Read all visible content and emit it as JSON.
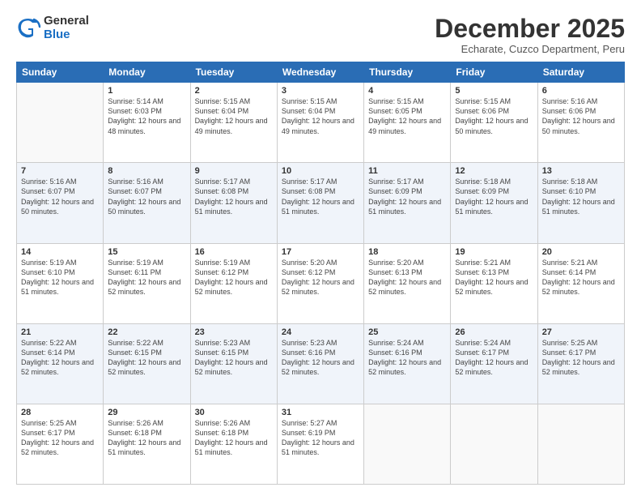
{
  "logo": {
    "general": "General",
    "blue": "Blue"
  },
  "header": {
    "month": "December 2025",
    "location": "Echarate, Cuzco Department, Peru"
  },
  "days_of_week": [
    "Sunday",
    "Monday",
    "Tuesday",
    "Wednesday",
    "Thursday",
    "Friday",
    "Saturday"
  ],
  "weeks": [
    [
      {
        "day": "",
        "sunrise": "",
        "sunset": "",
        "daylight": ""
      },
      {
        "day": "1",
        "sunrise": "Sunrise: 5:14 AM",
        "sunset": "Sunset: 6:03 PM",
        "daylight": "Daylight: 12 hours and 48 minutes."
      },
      {
        "day": "2",
        "sunrise": "Sunrise: 5:15 AM",
        "sunset": "Sunset: 6:04 PM",
        "daylight": "Daylight: 12 hours and 49 minutes."
      },
      {
        "day": "3",
        "sunrise": "Sunrise: 5:15 AM",
        "sunset": "Sunset: 6:04 PM",
        "daylight": "Daylight: 12 hours and 49 minutes."
      },
      {
        "day": "4",
        "sunrise": "Sunrise: 5:15 AM",
        "sunset": "Sunset: 6:05 PM",
        "daylight": "Daylight: 12 hours and 49 minutes."
      },
      {
        "day": "5",
        "sunrise": "Sunrise: 5:15 AM",
        "sunset": "Sunset: 6:06 PM",
        "daylight": "Daylight: 12 hours and 50 minutes."
      },
      {
        "day": "6",
        "sunrise": "Sunrise: 5:16 AM",
        "sunset": "Sunset: 6:06 PM",
        "daylight": "Daylight: 12 hours and 50 minutes."
      }
    ],
    [
      {
        "day": "7",
        "sunrise": "Sunrise: 5:16 AM",
        "sunset": "Sunset: 6:07 PM",
        "daylight": "Daylight: 12 hours and 50 minutes."
      },
      {
        "day": "8",
        "sunrise": "Sunrise: 5:16 AM",
        "sunset": "Sunset: 6:07 PM",
        "daylight": "Daylight: 12 hours and 50 minutes."
      },
      {
        "day": "9",
        "sunrise": "Sunrise: 5:17 AM",
        "sunset": "Sunset: 6:08 PM",
        "daylight": "Daylight: 12 hours and 51 minutes."
      },
      {
        "day": "10",
        "sunrise": "Sunrise: 5:17 AM",
        "sunset": "Sunset: 6:08 PM",
        "daylight": "Daylight: 12 hours and 51 minutes."
      },
      {
        "day": "11",
        "sunrise": "Sunrise: 5:17 AM",
        "sunset": "Sunset: 6:09 PM",
        "daylight": "Daylight: 12 hours and 51 minutes."
      },
      {
        "day": "12",
        "sunrise": "Sunrise: 5:18 AM",
        "sunset": "Sunset: 6:09 PM",
        "daylight": "Daylight: 12 hours and 51 minutes."
      },
      {
        "day": "13",
        "sunrise": "Sunrise: 5:18 AM",
        "sunset": "Sunset: 6:10 PM",
        "daylight": "Daylight: 12 hours and 51 minutes."
      }
    ],
    [
      {
        "day": "14",
        "sunrise": "Sunrise: 5:19 AM",
        "sunset": "Sunset: 6:10 PM",
        "daylight": "Daylight: 12 hours and 51 minutes."
      },
      {
        "day": "15",
        "sunrise": "Sunrise: 5:19 AM",
        "sunset": "Sunset: 6:11 PM",
        "daylight": "Daylight: 12 hours and 52 minutes."
      },
      {
        "day": "16",
        "sunrise": "Sunrise: 5:19 AM",
        "sunset": "Sunset: 6:12 PM",
        "daylight": "Daylight: 12 hours and 52 minutes."
      },
      {
        "day": "17",
        "sunrise": "Sunrise: 5:20 AM",
        "sunset": "Sunset: 6:12 PM",
        "daylight": "Daylight: 12 hours and 52 minutes."
      },
      {
        "day": "18",
        "sunrise": "Sunrise: 5:20 AM",
        "sunset": "Sunset: 6:13 PM",
        "daylight": "Daylight: 12 hours and 52 minutes."
      },
      {
        "day": "19",
        "sunrise": "Sunrise: 5:21 AM",
        "sunset": "Sunset: 6:13 PM",
        "daylight": "Daylight: 12 hours and 52 minutes."
      },
      {
        "day": "20",
        "sunrise": "Sunrise: 5:21 AM",
        "sunset": "Sunset: 6:14 PM",
        "daylight": "Daylight: 12 hours and 52 minutes."
      }
    ],
    [
      {
        "day": "21",
        "sunrise": "Sunrise: 5:22 AM",
        "sunset": "Sunset: 6:14 PM",
        "daylight": "Daylight: 12 hours and 52 minutes."
      },
      {
        "day": "22",
        "sunrise": "Sunrise: 5:22 AM",
        "sunset": "Sunset: 6:15 PM",
        "daylight": "Daylight: 12 hours and 52 minutes."
      },
      {
        "day": "23",
        "sunrise": "Sunrise: 5:23 AM",
        "sunset": "Sunset: 6:15 PM",
        "daylight": "Daylight: 12 hours and 52 minutes."
      },
      {
        "day": "24",
        "sunrise": "Sunrise: 5:23 AM",
        "sunset": "Sunset: 6:16 PM",
        "daylight": "Daylight: 12 hours and 52 minutes."
      },
      {
        "day": "25",
        "sunrise": "Sunrise: 5:24 AM",
        "sunset": "Sunset: 6:16 PM",
        "daylight": "Daylight: 12 hours and 52 minutes."
      },
      {
        "day": "26",
        "sunrise": "Sunrise: 5:24 AM",
        "sunset": "Sunset: 6:17 PM",
        "daylight": "Daylight: 12 hours and 52 minutes."
      },
      {
        "day": "27",
        "sunrise": "Sunrise: 5:25 AM",
        "sunset": "Sunset: 6:17 PM",
        "daylight": "Daylight: 12 hours and 52 minutes."
      }
    ],
    [
      {
        "day": "28",
        "sunrise": "Sunrise: 5:25 AM",
        "sunset": "Sunset: 6:17 PM",
        "daylight": "Daylight: 12 hours and 52 minutes."
      },
      {
        "day": "29",
        "sunrise": "Sunrise: 5:26 AM",
        "sunset": "Sunset: 6:18 PM",
        "daylight": "Daylight: 12 hours and 51 minutes."
      },
      {
        "day": "30",
        "sunrise": "Sunrise: 5:26 AM",
        "sunset": "Sunset: 6:18 PM",
        "daylight": "Daylight: 12 hours and 51 minutes."
      },
      {
        "day": "31",
        "sunrise": "Sunrise: 5:27 AM",
        "sunset": "Sunset: 6:19 PM",
        "daylight": "Daylight: 12 hours and 51 minutes."
      },
      {
        "day": "",
        "sunrise": "",
        "sunset": "",
        "daylight": ""
      },
      {
        "day": "",
        "sunrise": "",
        "sunset": "",
        "daylight": ""
      },
      {
        "day": "",
        "sunrise": "",
        "sunset": "",
        "daylight": ""
      }
    ]
  ]
}
